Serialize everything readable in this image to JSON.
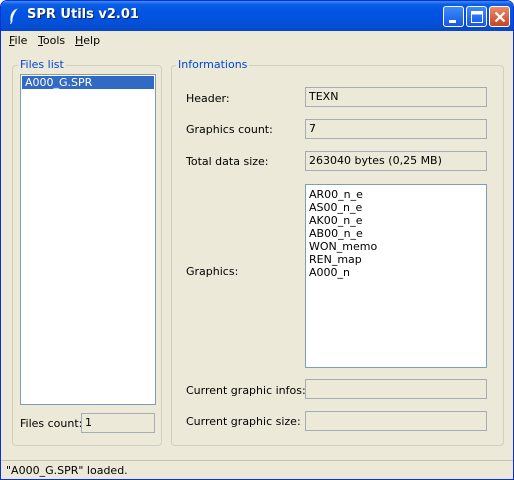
{
  "window": {
    "title": "SPR Utils v2.01"
  },
  "menu": {
    "file": "File",
    "tools": "Tools",
    "help": "Help"
  },
  "files_panel": {
    "legend": "Files list",
    "files": [
      "A000_G.SPR"
    ],
    "selected_index": 0,
    "count_label": "Files count:",
    "count_value": "1"
  },
  "info_panel": {
    "legend": "Informations",
    "header_label": "Header:",
    "header_value": "TEXN",
    "graphics_count_label": "Graphics count:",
    "graphics_count_value": "7",
    "total_size_label": "Total data size:",
    "total_size_value": "263040 bytes (0,25 MB)",
    "graphics_label": "Graphics:",
    "graphics": [
      "AR00_n_e",
      "AS00_n_e",
      "AK00_n_e",
      "AB00_n_e",
      "WON_memo",
      "REN_map",
      "A000_n"
    ],
    "current_infos_label": "Current graphic infos:",
    "current_infos_value": "",
    "current_size_label": "Current graphic size:",
    "current_size_value": ""
  },
  "status": {
    "text": "\"A000_G.SPR\" loaded."
  },
  "colors": {
    "titlebar": "#0054e3",
    "selection": "#316ac5",
    "group_legend": "#0046d5"
  }
}
